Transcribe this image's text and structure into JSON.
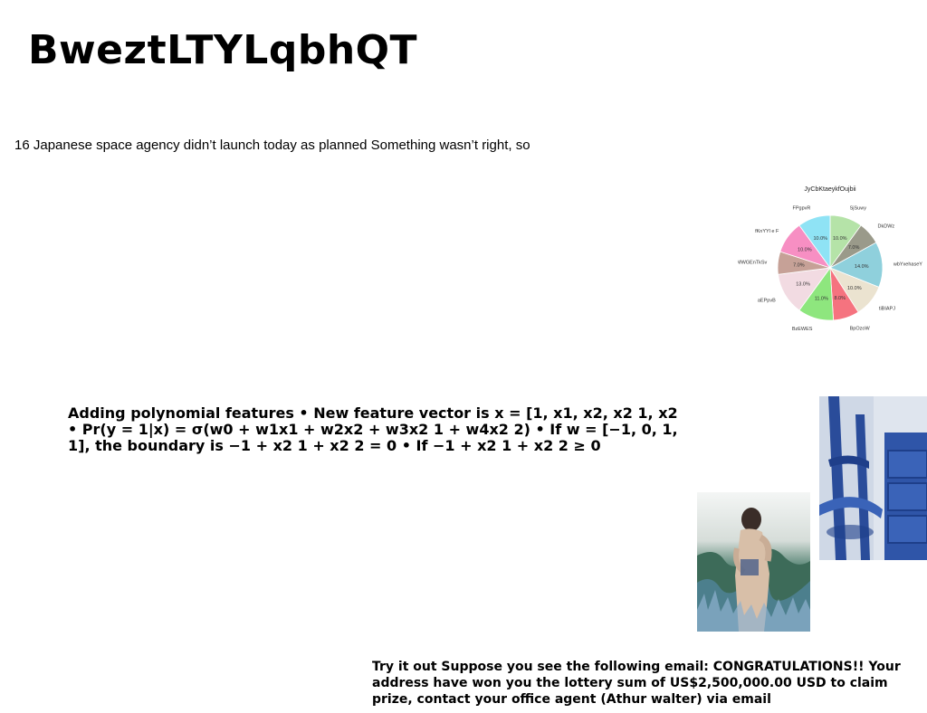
{
  "title": "BweztLTYLqbhQT",
  "text_line": "16 Japanese space agency didn’t launch today as planned Something wasn’t right, so",
  "polynomial_text": "Adding polynomial features • New feature vector is x = [1, x1, x2, x2 1, x2 • Pr(y = 1|x) = σ(w0 + w1x1 + w2x2 + w3x2 1 + w4x2 2) • If w = [−1, 0, 1, 1], the boundary is −1 + x2 1 + x2 2 = 0 • If −1 + x2 1 + x2 2 ≥ 0",
  "email_text": "Try it out Suppose you see the following email: CONGRATULATIONS!! Your address have won you the lottery sum of US$2,500,000.00 USD to claim prize, contact your office agent (Athur walter) via email",
  "chart_data": {
    "type": "pie",
    "title": "JyCbKtaeykfOujbii",
    "slices": [
      {
        "label": "SjSuwy",
        "value": 10.0,
        "pct": "10.0%",
        "color": "#b5e3a8"
      },
      {
        "label": "DkDWz",
        "value": 7.0,
        "pct": "7.0%",
        "color": "#9a9a8a"
      },
      {
        "label": "wbYxehaseY",
        "value": 14.0,
        "pct": "14.0%",
        "color": "#8fd0dc"
      },
      {
        "label": "tiBIAPJ",
        "value": 10.0,
        "pct": "10.0%",
        "color": "#ebe3d0"
      },
      {
        "label": "BpOzoW",
        "value": 8.0,
        "pct": "8.0%",
        "color": "#f5737f"
      },
      {
        "label": "BzEWES",
        "value": 11.0,
        "pct": "11.0%",
        "color": "#8ee67e"
      },
      {
        "label": "aEPpvB",
        "value": 13.0,
        "pct": "13.0%",
        "color": "#f2dbe2"
      },
      {
        "label": "MWGEnTkSv",
        "value": 7.0,
        "pct": "7.0%",
        "color": "#c6a197"
      },
      {
        "label": "fKnYYl e F",
        "value": 10.0,
        "pct": "10.0%",
        "color": "#f78fc3"
      },
      {
        "label": "FPgpvR",
        "value": 10.0,
        "pct": "10.0%",
        "color": "#8fe3f5"
      }
    ]
  },
  "photos": [
    {
      "subject": "woman-in-field-photo"
    },
    {
      "subject": "blue-chair-photo"
    }
  ]
}
